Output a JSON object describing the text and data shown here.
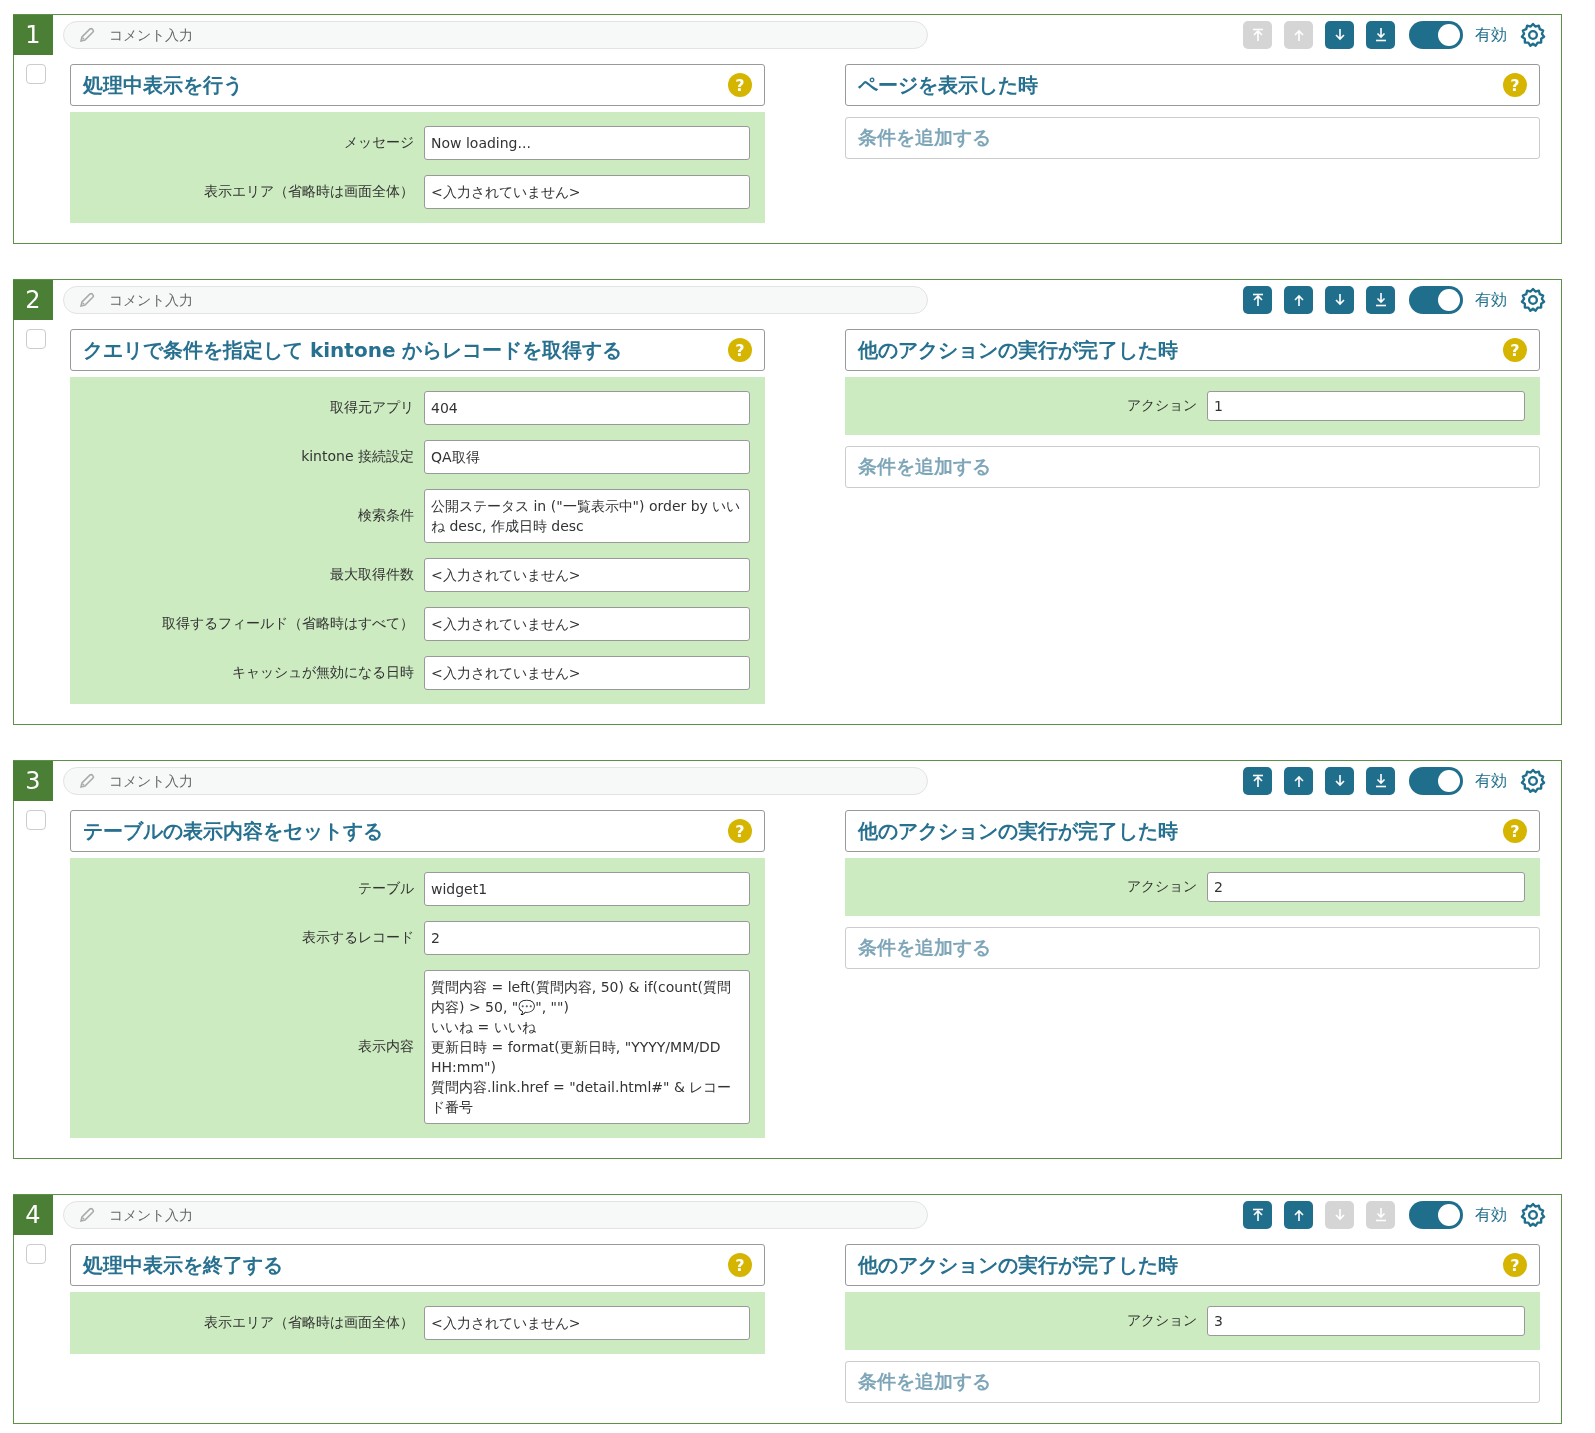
{
  "blocks": [
    {
      "number": "1",
      "comment_placeholder": "コメント入力",
      "moves": [
        {
          "kind": "top",
          "disabled": true
        },
        {
          "kind": "up",
          "disabled": true
        },
        {
          "kind": "down",
          "disabled": false
        },
        {
          "kind": "bottom",
          "disabled": false
        }
      ],
      "enabled": {
        "on": true,
        "label": "有効"
      },
      "checked": false,
      "action": {
        "title": "処理中表示を行う",
        "help": "?",
        "fields": [
          {
            "label": "メッセージ",
            "value": "Now loading..."
          },
          {
            "label": "表示エリア（省略時は画面全体）",
            "value": "<入力されていません>"
          }
        ]
      },
      "trigger": {
        "title": "ページを表示した時",
        "help": "?",
        "add_condition": "条件を追加する"
      }
    },
    {
      "number": "2",
      "comment_placeholder": "コメント入力",
      "moves": [
        {
          "kind": "top",
          "disabled": false
        },
        {
          "kind": "up",
          "disabled": false
        },
        {
          "kind": "down",
          "disabled": false
        },
        {
          "kind": "bottom",
          "disabled": false
        }
      ],
      "enabled": {
        "on": true,
        "label": "有効"
      },
      "checked": false,
      "action": {
        "title": "クエリで条件を指定して kintone からレコードを取得する",
        "help": "?",
        "fields": [
          {
            "label": "取得元アプリ",
            "value": "404"
          },
          {
            "label": "kintone 接続設定",
            "value": "QA取得"
          },
          {
            "label": "検索条件",
            "value": "公開ステータス in (\"一覧表示中\") order by いいね desc, 作成日時 desc"
          },
          {
            "label": "最大取得件数",
            "value": "<入力されていません>"
          },
          {
            "label": "取得するフィールド（省略時はすべて）",
            "value": "<入力されていません>"
          },
          {
            "label": "キャッシュが無効になる日時",
            "value": "<入力されていません>"
          }
        ]
      },
      "trigger": {
        "title": "他のアクションの実行が完了した時",
        "help": "?",
        "fields": [
          {
            "label": "アクション",
            "value": "1"
          }
        ],
        "add_condition": "条件を追加する"
      }
    },
    {
      "number": "3",
      "comment_placeholder": "コメント入力",
      "moves": [
        {
          "kind": "top",
          "disabled": false
        },
        {
          "kind": "up",
          "disabled": false
        },
        {
          "kind": "down",
          "disabled": false
        },
        {
          "kind": "bottom",
          "disabled": false
        }
      ],
      "enabled": {
        "on": true,
        "label": "有効"
      },
      "checked": false,
      "action": {
        "title": "テーブルの表示内容をセットする",
        "help": "?",
        "fields": [
          {
            "label": "テーブル",
            "value": "widget1"
          },
          {
            "label": "表示するレコード",
            "value": "2"
          },
          {
            "label": "表示内容",
            "lines": [
              "質問内容 = left(質問内容, 50) & if(count(質問内容) > 50, \"💬\", \"\")",
              "いいね = いいね",
              "更新日時 = format(更新日時, \"YYYY/MM/DD HH:mm\")",
              "質問内容.link.href = \"detail.html#\" & レコード番号"
            ]
          }
        ]
      },
      "trigger": {
        "title": "他のアクションの実行が完了した時",
        "help": "?",
        "fields": [
          {
            "label": "アクション",
            "value": "2"
          }
        ],
        "add_condition": "条件を追加する"
      }
    },
    {
      "number": "4",
      "comment_placeholder": "コメント入力",
      "moves": [
        {
          "kind": "top",
          "disabled": false
        },
        {
          "kind": "up",
          "disabled": false
        },
        {
          "kind": "down",
          "disabled": true
        },
        {
          "kind": "bottom",
          "disabled": true
        }
      ],
      "enabled": {
        "on": true,
        "label": "有効"
      },
      "checked": false,
      "action": {
        "title": "処理中表示を終了する",
        "help": "?",
        "fields": [
          {
            "label": "表示エリア（省略時は画面全体）",
            "value": "<入力されていません>"
          }
        ]
      },
      "trigger": {
        "title": "他のアクションの実行が完了した時",
        "help": "?",
        "fields": [
          {
            "label": "アクション",
            "value": "3"
          }
        ],
        "add_condition": "条件を追加する"
      }
    }
  ]
}
